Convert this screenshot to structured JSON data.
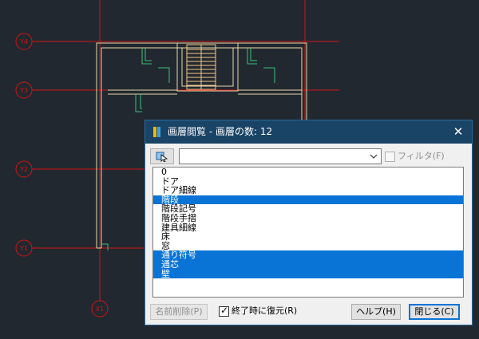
{
  "colors": {
    "background": "#212830",
    "grid_line": "#d21414",
    "wall_line": "#e8d9a8",
    "stair_line": "#f5c986",
    "door_line": "#39c47a",
    "titlebar": "#1a4466",
    "selection": "#0a74d6"
  },
  "grid_labels": [
    "Y4",
    "Y3",
    "Y2",
    "Y1",
    "X1"
  ],
  "dialog": {
    "title": "画層閲覧 - 画層の数: 12",
    "close_icon": "close-icon",
    "combo_value": "",
    "filter_label": "フィルタ(F)",
    "filter_checked": false,
    "layers": [
      {
        "name": "0",
        "selected": false
      },
      {
        "name": "ドア",
        "selected": false
      },
      {
        "name": "ドア細線",
        "selected": false
      },
      {
        "name": "階段",
        "selected": true
      },
      {
        "name": "階段記号",
        "selected": false
      },
      {
        "name": "階段手摺",
        "selected": false
      },
      {
        "name": "建具細線",
        "selected": false
      },
      {
        "name": "床",
        "selected": false
      },
      {
        "name": "窓",
        "selected": false
      },
      {
        "name": "通り符号",
        "selected": true
      },
      {
        "name": "通芯",
        "selected": true
      },
      {
        "name": "壁",
        "selected": true
      }
    ],
    "delete_label": "名前削除(P)",
    "restore_label": "終了時に復元(R)",
    "restore_checked": true,
    "help_label": "ヘルプ(H)",
    "close_label": "閉じる(C)"
  }
}
